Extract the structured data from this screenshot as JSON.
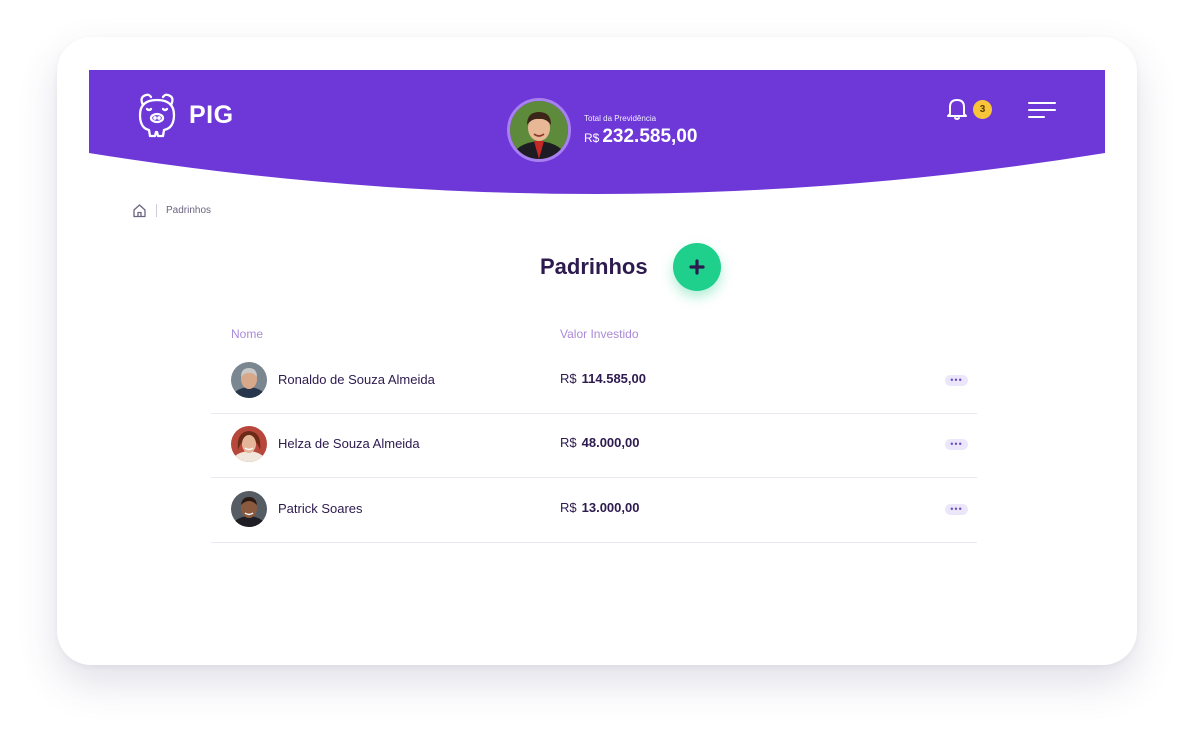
{
  "header": {
    "app_name": "PIG",
    "total_label": "Total da Previdência",
    "total_currency": "R$",
    "total_value": "232.585,00",
    "notification_count": "3"
  },
  "breadcrumb": {
    "current": "Padrinhos"
  },
  "page": {
    "title": "Padrinhos"
  },
  "table": {
    "columns": {
      "name": "Nome",
      "value": "Valor Investido"
    },
    "rows": [
      {
        "name": "Ronaldo de Souza Almeida",
        "currency": "R$",
        "value": "114.585,00",
        "more": "•••"
      },
      {
        "name": "Helza de Souza Almeida",
        "currency": "R$",
        "value": "48.000,00",
        "more": "•••"
      },
      {
        "name": "Patrick Soares",
        "currency": "R$",
        "value": "13.000,00",
        "more": "•••"
      }
    ]
  },
  "colors": {
    "brand_purple": "#6e38d9",
    "add_button": "#1fcf8c",
    "badge": "#f8c53a",
    "text_dark": "#2d1a4e",
    "column_header": "#a98ad8"
  },
  "icons": [
    "piggy-bank-icon",
    "bell-icon",
    "hamburger-menu-icon",
    "home-icon",
    "plus-icon",
    "more-icon"
  ]
}
